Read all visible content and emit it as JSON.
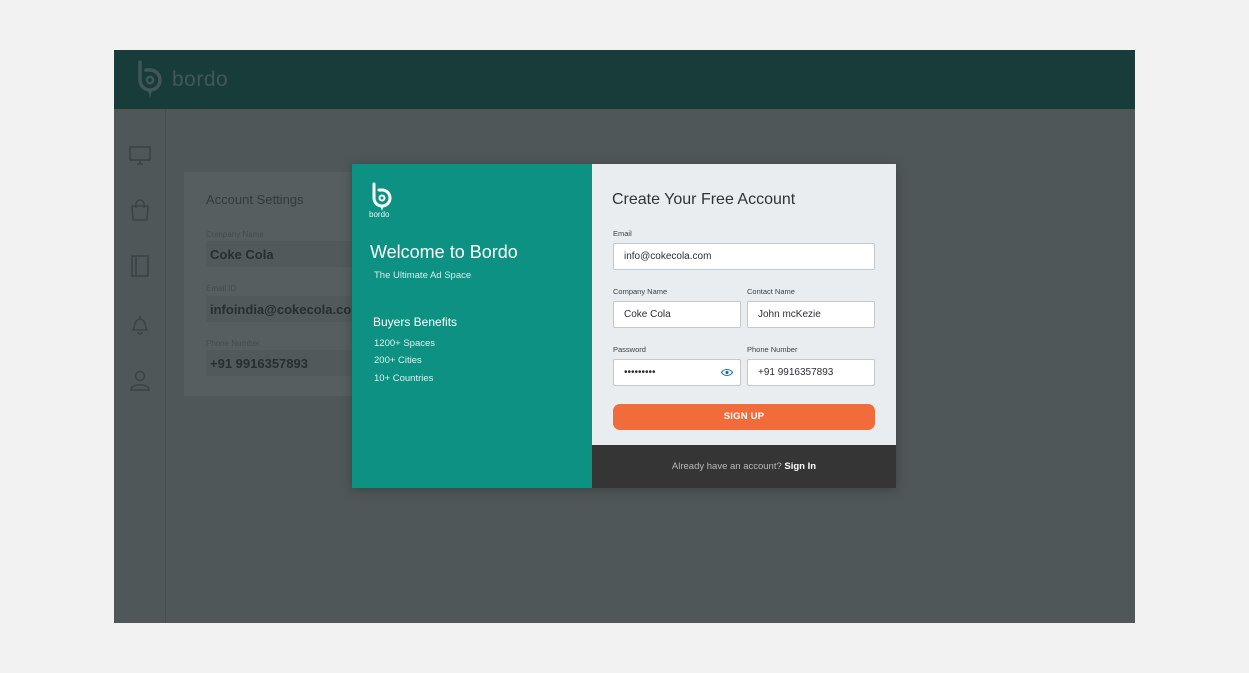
{
  "app": {
    "brand": "bordo",
    "sidebar_icons": [
      "monitor-icon",
      "shopping-bag-icon",
      "book-icon",
      "bell-icon",
      "user-icon"
    ]
  },
  "settings": {
    "title": "Account Settings",
    "company_label": "Company Name",
    "company_value": "Coke Cola",
    "email_label": "Email ID",
    "email_value": "infoindia@cokecola.com",
    "phone_label": "Phone Number",
    "phone_value": "+91 9916357893"
  },
  "modal": {
    "left": {
      "logo_text": "bordo",
      "welcome": "Welcome to Bordo",
      "tagline": "The Ultimate Ad Space",
      "benefits_title": "Buyers Benefits",
      "benefits": [
        "1200+ Spaces",
        "200+ Cities",
        "10+ Countries"
      ]
    },
    "form": {
      "title": "Create Your Free Account",
      "email_label": "Email",
      "email_value": "info@cokecola.com",
      "company_label": "Company Name",
      "company_value": "Coke Cola",
      "contact_label": "Contact Name",
      "contact_value": "John mcKezie",
      "password_label": "Password",
      "password_value": "•••••••••",
      "phone_label": "Phone Number",
      "phone_value": "+91 9916357893",
      "signup_label": "SIGN UP"
    },
    "footer": {
      "prompt": "Already have an account? ",
      "signin_label": "Sign In"
    }
  },
  "colors": {
    "brand_teal": "#0c9183",
    "topbar": "#1d6660",
    "accent_orange": "#f26b3a",
    "footer_dark": "#353535"
  }
}
